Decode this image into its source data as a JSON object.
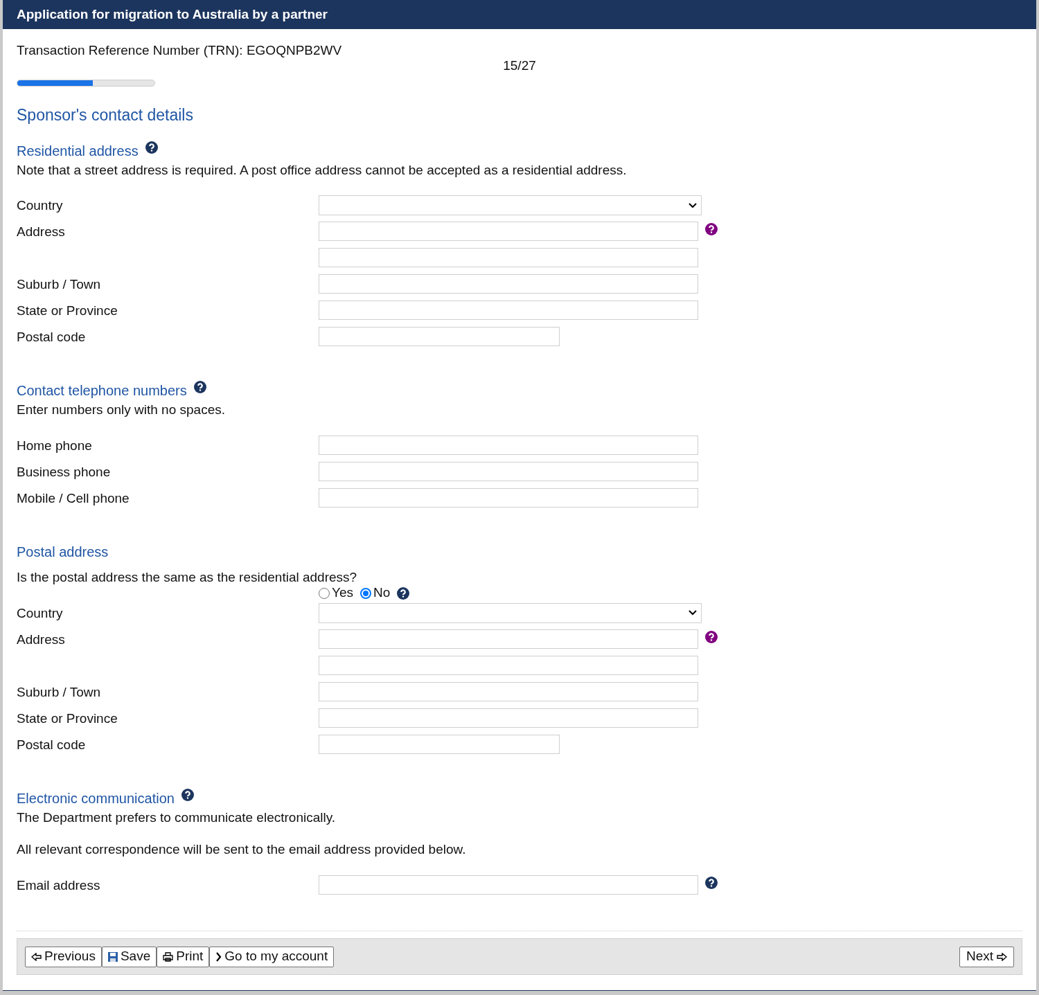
{
  "header": {
    "title": "Application for migration to Australia by a partner"
  },
  "trn": "Transaction Reference Number (TRN): EGOQNPB2WV",
  "progress": {
    "reading": "15/27",
    "level": 0.55
  },
  "page_title": "Sponsor's contact details",
  "sections": [
    {
      "heading": "Residential address",
      "help": {
        "color": "#1c355e"
      },
      "notes": [
        "Note that a street address is required. A post office address cannot be accepted as a residential address."
      ],
      "fields": [
        {
          "kind": "select",
          "label": "Country"
        },
        {
          "kind": "text",
          "label": "Address",
          "help": {
            "color": "#800080"
          }
        },
        {
          "kind": "text"
        },
        {
          "kind": "text",
          "label": "Suburb / Town"
        },
        {
          "kind": "text",
          "label": "State or Province"
        },
        {
          "kind": "short",
          "label": "Postal code"
        }
      ]
    },
    {
      "heading": "Contact telephone numbers",
      "help": {
        "color": "#1c355e"
      },
      "notes": [
        "Enter numbers only with no spaces."
      ],
      "fields": [
        {
          "kind": "text",
          "label": "Home phone"
        },
        {
          "kind": "text",
          "label": "Business phone"
        },
        {
          "kind": "text",
          "label": "Mobile / Cell phone"
        }
      ]
    },
    {
      "heading": "Postal address",
      "fields": [
        {
          "kind": "radio",
          "question": "Is the postal address the same as the residential address?",
          "options": [
            {
              "label": "Yes",
              "selected": false
            },
            {
              "label": "No",
              "selected": true
            }
          ],
          "help": {
            "color": "#1c355e"
          }
        },
        {
          "kind": "select",
          "label": "Country"
        },
        {
          "kind": "text",
          "label": "Address",
          "help": {
            "color": "#800080"
          }
        },
        {
          "kind": "text"
        },
        {
          "kind": "text",
          "label": "Suburb / Town"
        },
        {
          "kind": "text",
          "label": "State or Province"
        },
        {
          "kind": "short",
          "label": "Postal code"
        }
      ]
    },
    {
      "heading": "Electronic communication",
      "help": {
        "color": "#1c355e"
      },
      "notes": [
        "The Department prefers to communicate electronically.",
        "All relevant correspondence will be sent to the email address provided below."
      ],
      "fields": [
        {
          "kind": "text",
          "label": "Email address",
          "help": {
            "color": "#1c355e"
          }
        }
      ]
    }
  ],
  "buttons": [
    {
      "kind": "previous",
      "label": "Previous"
    },
    {
      "kind": "save",
      "label": "Save"
    },
    {
      "kind": "print",
      "label": "Print"
    },
    {
      "kind": "account",
      "label": "Go to my account"
    }
  ],
  "next": {
    "label": "Next"
  }
}
